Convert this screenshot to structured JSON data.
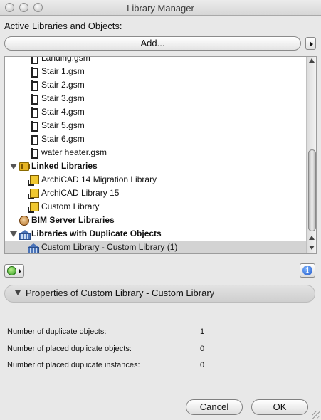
{
  "window": {
    "title": "Library Manager"
  },
  "header": {
    "section_label": "Active Libraries and Objects:",
    "add_button": "Add..."
  },
  "tree": {
    "items": [
      {
        "label": "Landing.gsm",
        "icon": "stair-object-icon",
        "indent": 2,
        "bold": false
      },
      {
        "label": "Stair 1.gsm",
        "icon": "stair-object-icon",
        "indent": 2,
        "bold": false
      },
      {
        "label": "Stair 2.gsm",
        "icon": "stair-object-icon",
        "indent": 2,
        "bold": false
      },
      {
        "label": "Stair 3.gsm",
        "icon": "stair-object-icon",
        "indent": 2,
        "bold": false
      },
      {
        "label": "Stair 4.gsm",
        "icon": "stair-object-icon",
        "indent": 2,
        "bold": false
      },
      {
        "label": "Stair 5.gsm",
        "icon": "stair-object-icon",
        "indent": 2,
        "bold": false
      },
      {
        "label": "Stair 6.gsm",
        "icon": "stair-object-icon",
        "indent": 2,
        "bold": false
      },
      {
        "label": "water heater.gsm",
        "icon": "stair-object-icon",
        "indent": 2,
        "bold": false
      },
      {
        "label": "Linked Libraries",
        "icon": "library-folder-icon",
        "indent": 0,
        "bold": true,
        "expanded": true
      },
      {
        "label": "ArchiCAD 14 Migration Library",
        "icon": "linked-library-icon",
        "indent": 1,
        "bold": false
      },
      {
        "label": "ArchiCAD Library 15",
        "icon": "linked-library-icon",
        "indent": 1,
        "bold": false
      },
      {
        "label": "Custom Library",
        "icon": "linked-library-icon",
        "indent": 1,
        "bold": false
      },
      {
        "label": "BIM Server Libraries",
        "icon": "bim-server-icon",
        "indent": 0,
        "bold": true
      },
      {
        "label": "Libraries with Duplicate Objects",
        "icon": "duplicate-library-icon",
        "indent": 0,
        "bold": true,
        "expanded": true
      },
      {
        "label": "Custom Library - Custom Library (1)",
        "icon": "duplicate-library-icon",
        "indent": 1,
        "bold": false,
        "selected": true
      }
    ]
  },
  "properties": {
    "title": "Properties of Custom Library - Custom Library",
    "rows": [
      {
        "label": "Number of duplicate objects:",
        "value": "1"
      },
      {
        "label": "Number of placed duplicate objects:",
        "value": "0"
      },
      {
        "label": "Number of placed duplicate instances:",
        "value": "0"
      }
    ]
  },
  "footer": {
    "cancel_label": "Cancel",
    "ok_label": "OK"
  },
  "colors": {
    "window_bg": "#e8e8e8",
    "selection": "#d3d3d3",
    "info_blue": "#1e55c8",
    "refresh_green": "#2f9a1f"
  }
}
